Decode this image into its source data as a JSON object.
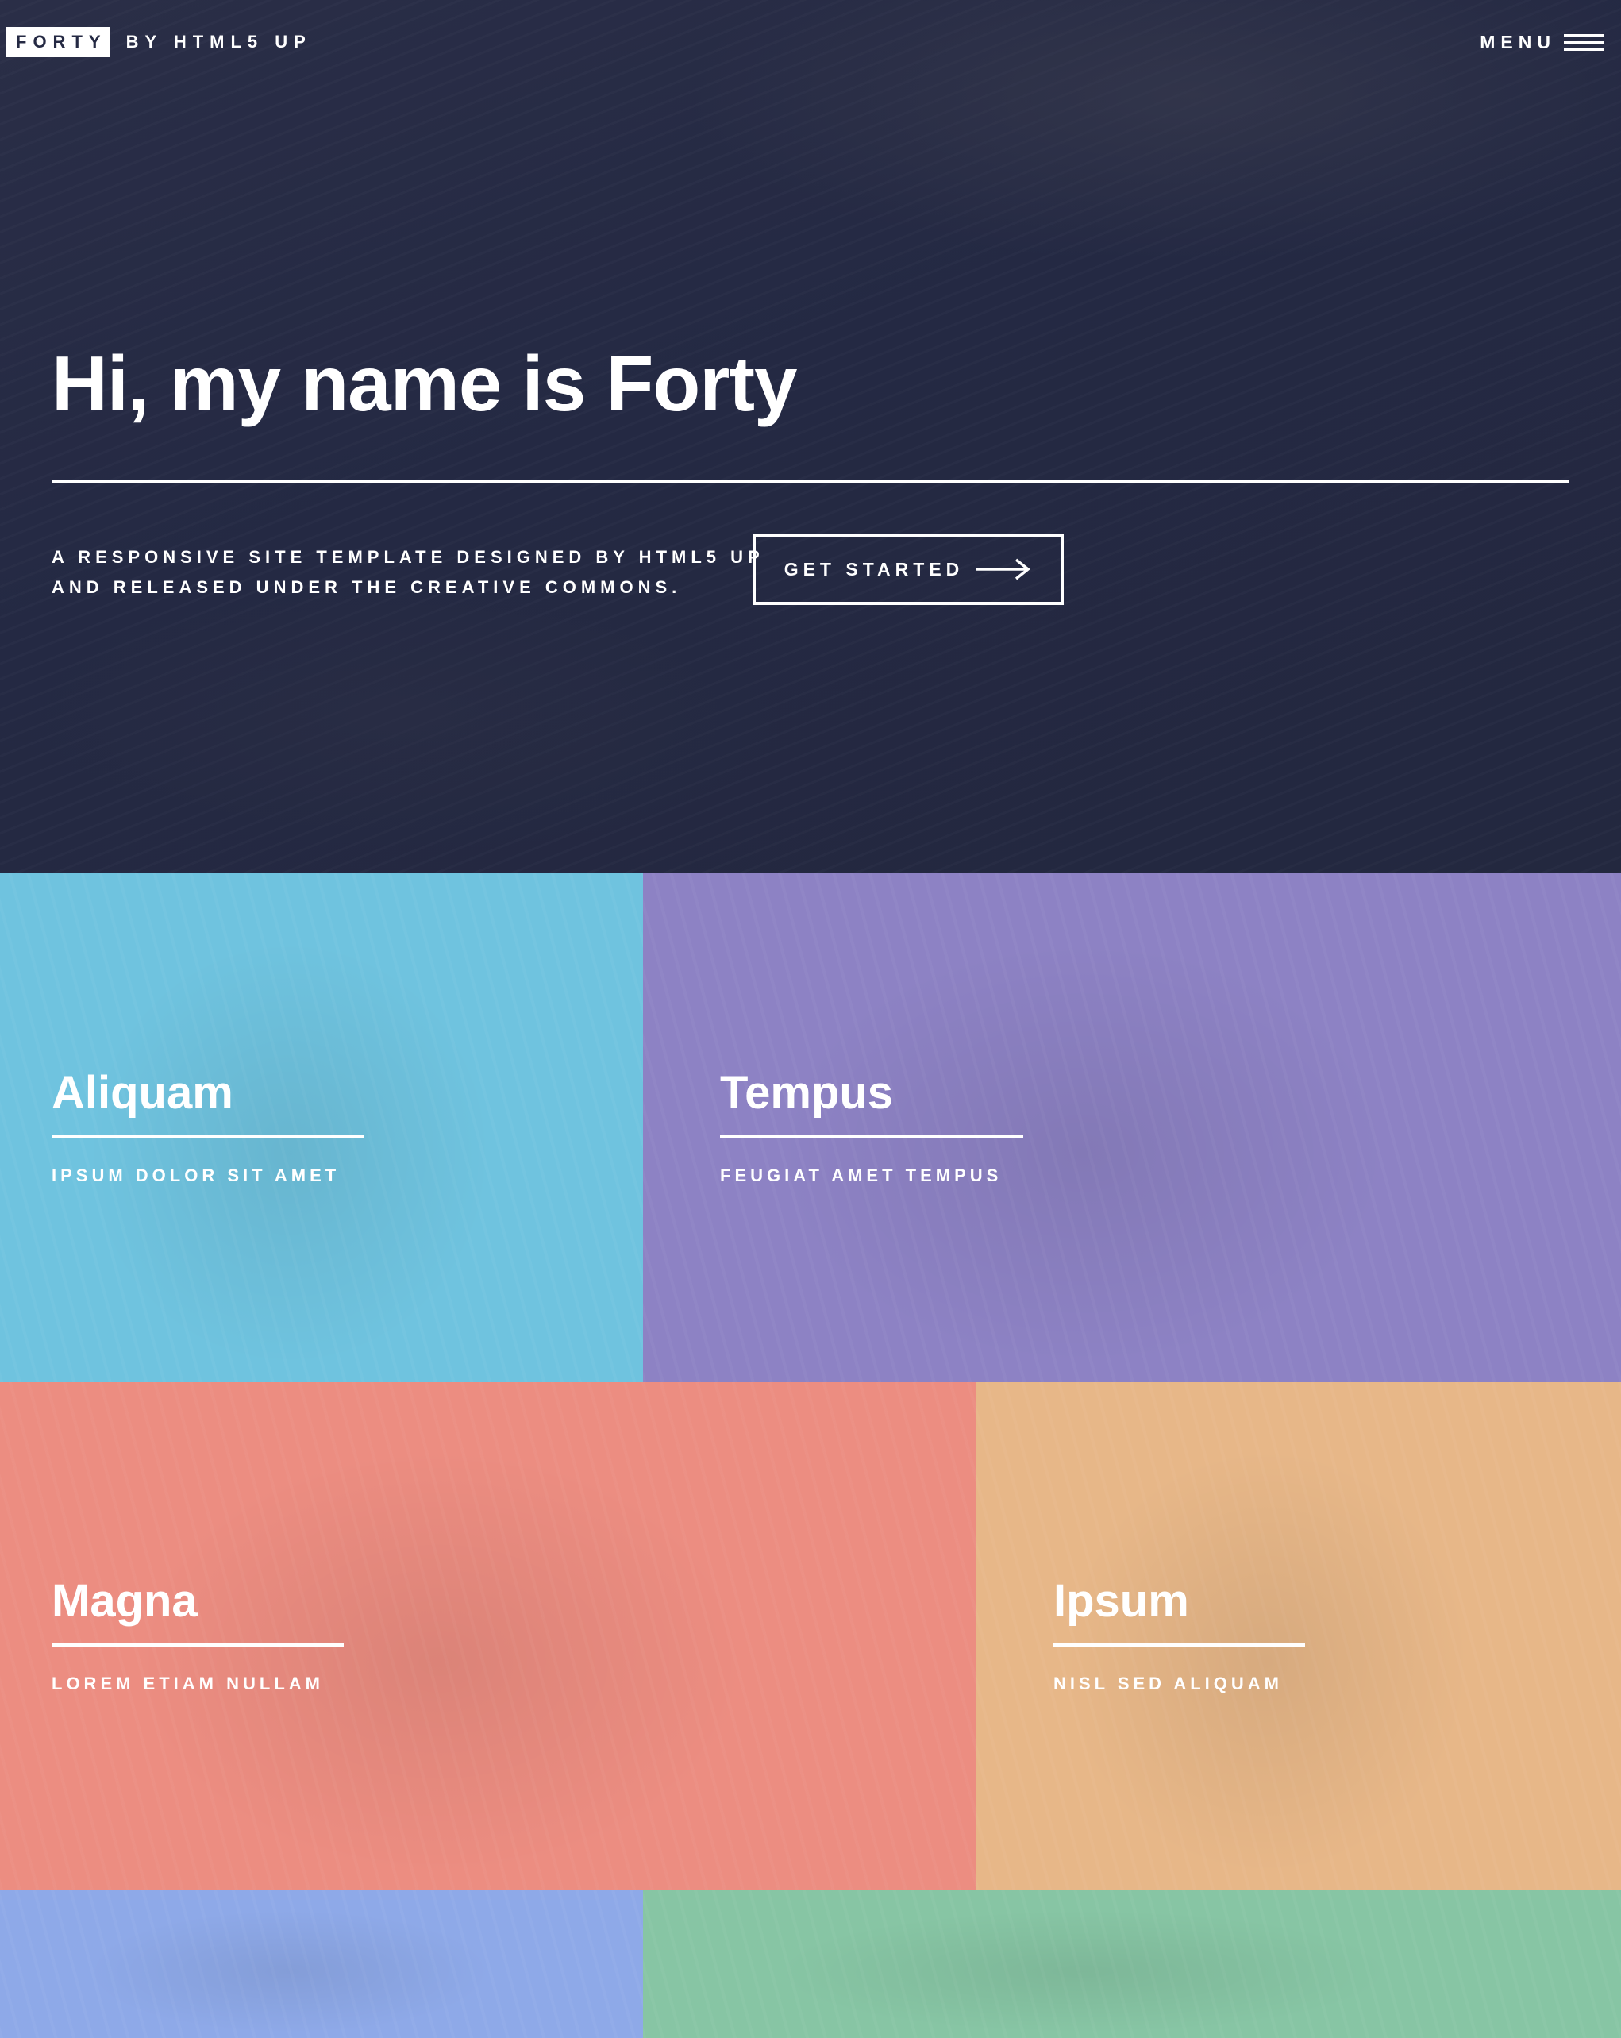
{
  "header": {
    "logo_text": "FORTY",
    "logo_by": "BY HTML5 UP",
    "menu_label": "MENU"
  },
  "banner": {
    "title": "Hi, my name is Forty",
    "text_line1": "A RESPONSIVE SITE TEMPLATE DESIGNED BY HTML5 UP",
    "text_line2": "AND RELEASED UNDER THE CREATIVE COMMONS.",
    "button_label": "GET STARTED"
  },
  "tiles": [
    {
      "title": "Aliquam",
      "subtitle": "IPSUM DOLOR SIT AMET",
      "color": "#6fc3df"
    },
    {
      "title": "Tempus",
      "subtitle": "FEUGIAT AMET TEMPUS",
      "color": "#8d82c4"
    },
    {
      "title": "Magna",
      "subtitle": "LOREM ETIAM NULLAM",
      "color": "#ec8d81"
    },
    {
      "title": "Ipsum",
      "subtitle": "NISL SED ALIQUAM",
      "color": "#e7b788"
    },
    {
      "title": "",
      "subtitle": "",
      "color": "#8ea9e8"
    },
    {
      "title": "",
      "subtitle": "",
      "color": "#87c5a4"
    }
  ],
  "colors": {
    "background": "#242943",
    "text": "#ffffff"
  },
  "icons": {
    "menu": "hamburger-icon",
    "cta_arrow": "arrow-right-icon"
  }
}
